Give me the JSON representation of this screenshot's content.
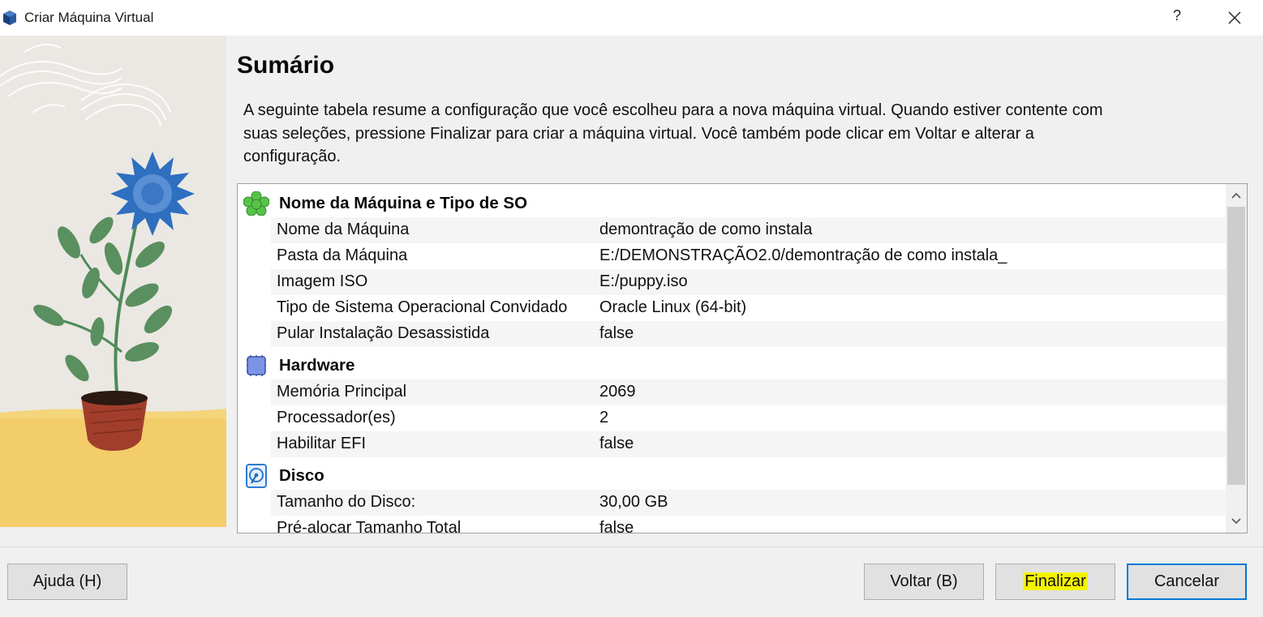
{
  "window": {
    "title": "Criar Máquina Virtual",
    "help_label": "?"
  },
  "page": {
    "title": "Sumário",
    "description": "A seguinte tabela resume a configuração que você escolheu para a nova máquina virtual. Quando estiver contente com suas seleções, pressione Finalizar para criar a máquina virtual. Você também pode clicar em Voltar e alterar a configuração."
  },
  "summary": {
    "groups": [
      {
        "title": "Nome da Máquina e Tipo de SO",
        "icon": "os-type-icon",
        "rows": [
          {
            "key": "Nome da Máquina",
            "value": "demontração de como instala"
          },
          {
            "key": "Pasta da Máquina",
            "value": "E:/DEMONSTRAÇÃO2.0/demontração de como instala_"
          },
          {
            "key": "Imagem ISO",
            "value": "E:/puppy.iso"
          },
          {
            "key": "Tipo de Sistema Operacional Convidado",
            "value": "Oracle Linux (64-bit)"
          },
          {
            "key": "Pular Instalação Desassistida",
            "value": "false"
          }
        ]
      },
      {
        "title": "Hardware",
        "icon": "chip-icon",
        "rows": [
          {
            "key": "Memória Principal",
            "value": "2069"
          },
          {
            "key": "Processador(es)",
            "value": "2"
          },
          {
            "key": "Habilitar EFI",
            "value": "false"
          }
        ]
      },
      {
        "title": "Disco",
        "icon": "hard-disk-icon",
        "rows": [
          {
            "key": "Tamanho do Disco:",
            "value": "30,00 GB"
          },
          {
            "key": "Pré-alocar Tamanho Total",
            "value": "false"
          }
        ]
      }
    ]
  },
  "buttons": {
    "help": "Ajuda (H)",
    "back": "Voltar (B)",
    "finish": "Finalizar",
    "cancel": "Cancelar"
  },
  "colors": {
    "highlight": "#f4f400",
    "focus_border": "#0078d7",
    "alt_row": "#f5f5f5"
  }
}
